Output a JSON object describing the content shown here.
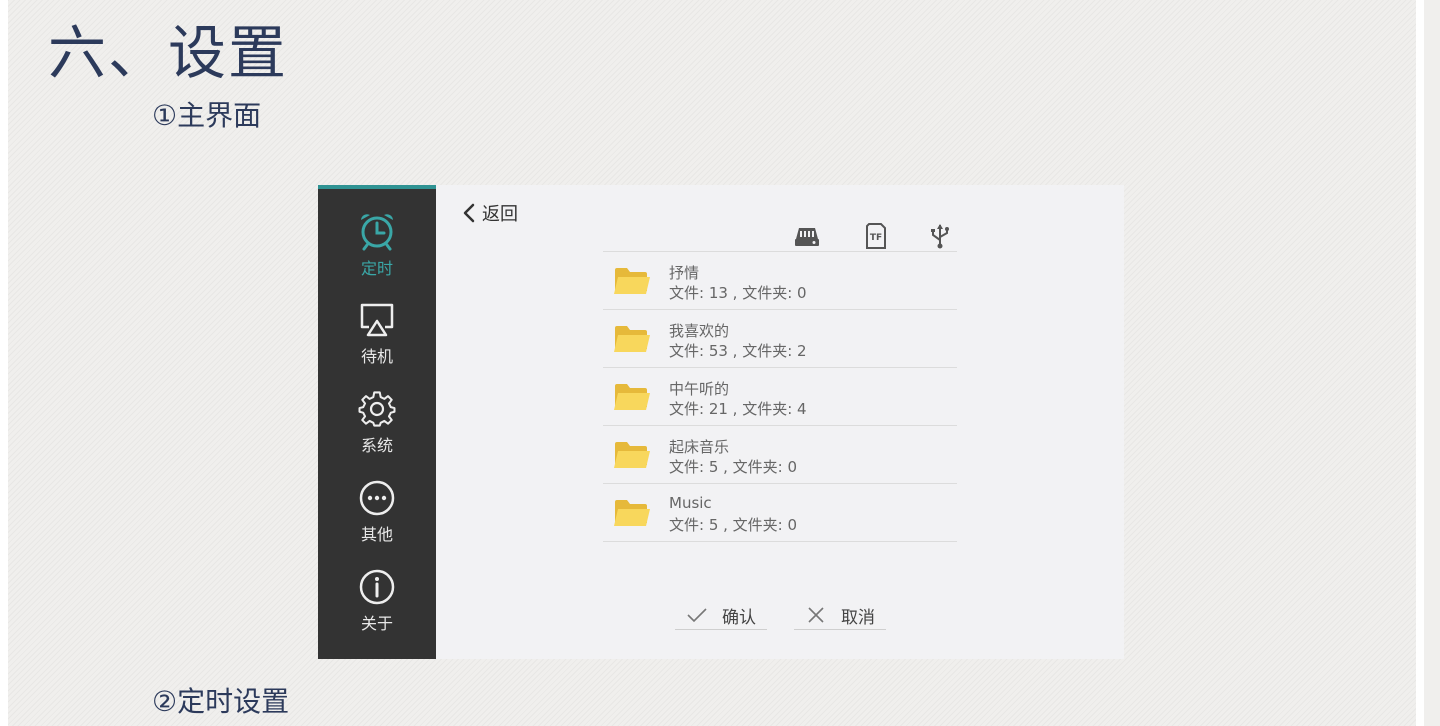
{
  "document": {
    "heading": "六、设置",
    "section1": "①主界面",
    "section2": "②定时设置"
  },
  "sidebar": {
    "accent_color": "#2f9393",
    "items": [
      {
        "label": "定时",
        "icon": "alarm-clock-icon",
        "active": true
      },
      {
        "label": "待机",
        "icon": "airplay-screen-icon",
        "active": false
      },
      {
        "label": "系统",
        "icon": "gear-icon",
        "active": false
      },
      {
        "label": "其他",
        "icon": "more-dots-icon",
        "active": false
      },
      {
        "label": "关于",
        "icon": "info-icon",
        "active": false
      }
    ]
  },
  "main": {
    "back_label": "返回",
    "storage_icons": [
      "hard-drive-icon",
      "tf-card-icon",
      "usb-icon"
    ],
    "tf_label": "TF",
    "folders": [
      {
        "name": "抒情",
        "info": "文件: 13 , 文件夹: 0"
      },
      {
        "name": "我喜欢的",
        "info": "文件: 53 , 文件夹: 2"
      },
      {
        "name": "中午听的",
        "info": "文件: 21 , 文件夹: 4"
      },
      {
        "name": "起床音乐",
        "info": "文件: 5 , 文件夹: 0"
      },
      {
        "name": "Music",
        "info": "文件: 5 , 文件夹: 0"
      }
    ],
    "confirm_label": "确认",
    "cancel_label": "取消"
  }
}
